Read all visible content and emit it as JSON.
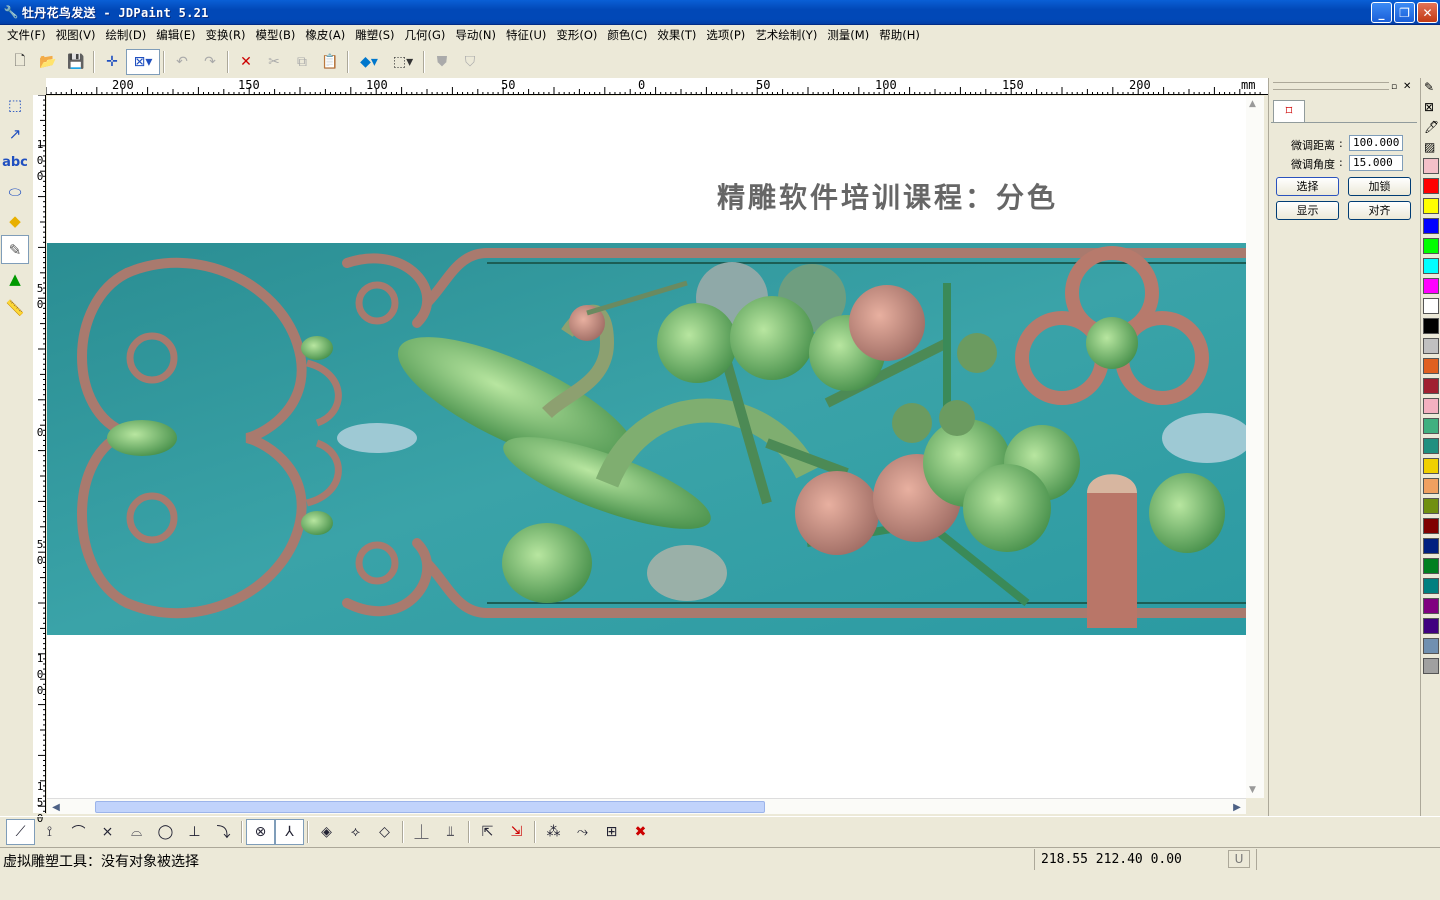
{
  "window": {
    "title": "牡丹花鸟发送 - JDPaint 5.21",
    "app_icon": "jdpaint-app-icon"
  },
  "menubar": {
    "items": [
      "文件(F)",
      "视图(V)",
      "绘制(D)",
      "编辑(E)",
      "变换(R)",
      "模型(B)",
      "橡皮(A)",
      "雕塑(S)",
      "几何(G)",
      "导动(N)",
      "特征(U)",
      "变形(O)",
      "颜色(C)",
      "效果(T)",
      "选项(P)",
      "艺术绘制(Y)",
      "测量(M)",
      "帮助(H)"
    ]
  },
  "toolbar": {
    "icons": [
      "new-file-icon",
      "open-folder-icon",
      "save-icon",
      "crosshair-icon",
      "select-box-icon",
      "undo-icon",
      "redo-icon",
      "delete-icon",
      "cut-icon",
      "copy-icon",
      "paste-icon",
      "color-cube-icon",
      "render-mode-icon",
      "shield-left-icon",
      "shield-right-icon"
    ]
  },
  "rulers": {
    "unit": "mm",
    "horizontal_labels": [
      "200",
      "150",
      "100",
      "50",
      "0",
      "50",
      "100",
      "150",
      "200"
    ],
    "vertical_labels": [
      "100",
      "50",
      "0",
      "50",
      "100",
      "150"
    ]
  },
  "canvas": {
    "title": "精雕软件培训课程：分色"
  },
  "right_panel": {
    "fine_distance_label": "微调距离",
    "fine_distance_value": "100.000",
    "fine_angle_label": "微调角度",
    "fine_angle_value": "15.000",
    "select_button": "选择",
    "lock_button": "加锁",
    "show_button": "显示",
    "align_button": "对齐"
  },
  "palette": {
    "colors": [
      "#f4c0c8",
      "#ff0000",
      "#ffff00",
      "#0000ff",
      "#00ff00",
      "#00ffff",
      "#ff00ff",
      "#ffffff",
      "#000000",
      "#c0c0c0",
      "#e06020",
      "#a02030",
      "#f4b0c0",
      "#40b080",
      "#209080",
      "#f0d000",
      "#f0a060",
      "#709010",
      "#800000",
      "#002080",
      "#008020",
      "#008080",
      "#800080",
      "#400080",
      "#7090b0",
      "#a0a0a0"
    ]
  },
  "status": {
    "message": "虚拟雕塑工具：没有对象被选择",
    "coordinates": "218.55 212.40 0.00",
    "flag": "U"
  }
}
